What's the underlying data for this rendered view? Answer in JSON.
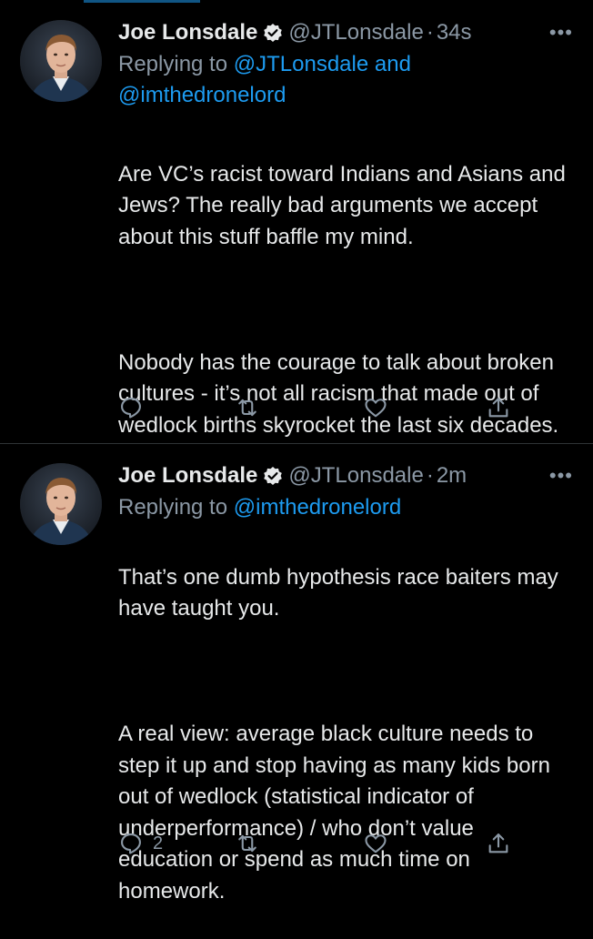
{
  "colors": {
    "background": "#000000",
    "text": "#e7e9ea",
    "secondary": "#8b98a5",
    "link": "#1d9bf0",
    "divider": "#2f3336"
  },
  "tweets": [
    {
      "author_name": "Joe Lonsdale",
      "handle": "@JTLonsdale",
      "separator": "·",
      "time": "34s",
      "more": "•••",
      "reply_prefix": "Replying to",
      "reply_mention_1": "@JTLonsdale",
      "reply_joiner": "and",
      "reply_mention_2": "@imthedronelord",
      "paragraph_1": "Are VC’s racist toward Indians and Asians and Jews?  The really bad arguments we accept about this stuff baffle my mind.",
      "paragraph_2": "Nobody has the courage to talk about broken cultures - it’s not all racism that made out of wedlock births skyrocket the last six decades.",
      "reply_count": "",
      "icons": [
        "reply-icon",
        "retweet-icon",
        "like-icon",
        "share-icon"
      ]
    },
    {
      "author_name": "Joe Lonsdale",
      "handle": "@JTLonsdale",
      "separator": "·",
      "time": "2m",
      "more": "•••",
      "reply_prefix": "Replying to",
      "reply_mention_1": "@imthedronelord",
      "paragraph_1": "That’s one dumb hypothesis race baiters may have taught you.",
      "paragraph_2": "A real view: average black culture needs to step it up and stop having as many kids born out of wedlock (statistical indicator of underperformance) / who don’t value education or spend as much time on homework.",
      "reply_count": "2",
      "icons": [
        "reply-icon",
        "retweet-icon",
        "like-icon",
        "share-icon"
      ]
    }
  ]
}
